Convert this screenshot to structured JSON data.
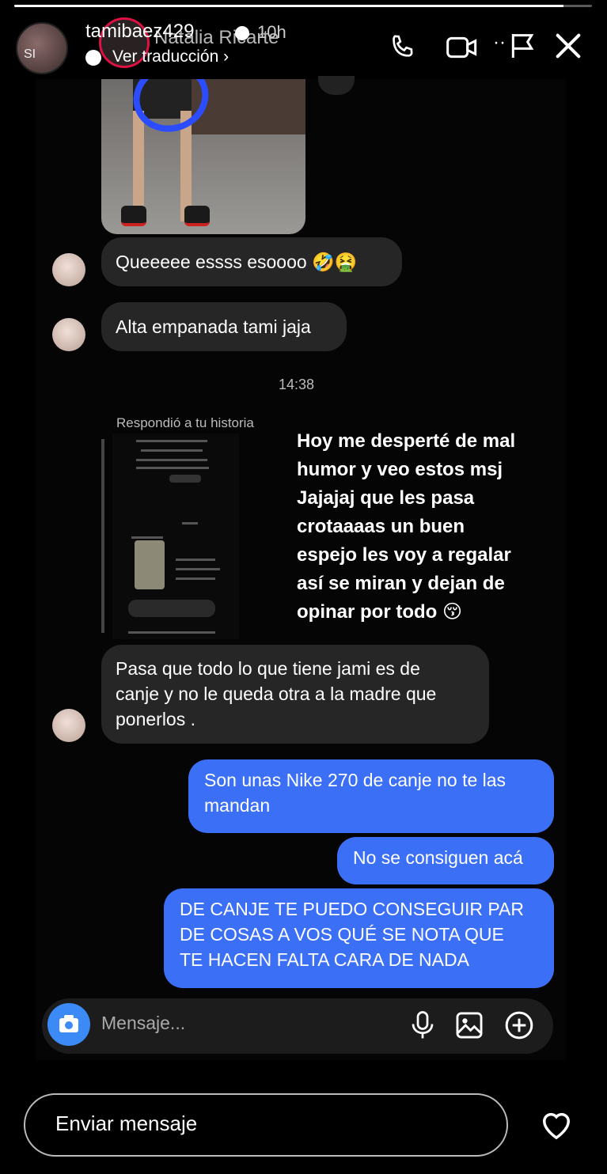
{
  "story": {
    "progress": 0.95,
    "username": "tamibaez429",
    "chat_contact": "Natalia Ricarte",
    "time": "10h",
    "translate": "Ver traducción",
    "avatar_text": "SI",
    "reply_placeholder": "Enviar mensaje"
  },
  "chat": {
    "messages_in": [
      {
        "text": "Queeeee essss esoooo 🤣🤮"
      },
      {
        "text": "Alta empanada tami jaja"
      }
    ],
    "timestamp": "14:38",
    "replied_label": "Respondió a tu historia",
    "long_in_lines": [
      "Pasa que todo lo que tiene jami es de",
      "canje y no le queda otra a la madre que",
      "ponerlos ."
    ],
    "out_messages": [
      {
        "lines": [
          "Son unas Nike 270 de canje no te las",
          "mandan"
        ]
      },
      {
        "lines": [
          "No se consiguen acá"
        ]
      },
      {
        "lines": [
          "DE CANJE TE PUEDO CONSEGUIR PAR",
          "DE COSAS A VOS QUÉ SE NOTA QUE",
          "TE HACEN FALTA CARA DE NADA"
        ]
      }
    ],
    "composer_placeholder": "Mensaje..."
  },
  "overlay_lines": [
    "Hoy me desperté de mal",
    "humor y veo estos msj",
    "Jajajaj que les pasa",
    "crotaaaas un buen",
    "espejo les voy a regalar",
    "así se miran y dejan de",
    "opinar por todo 😚"
  ],
  "icons": {
    "phone": "phone-icon",
    "video": "video-icon",
    "flag": "flag-icon",
    "close": "close-icon",
    "camera": "camera-icon",
    "mic": "microphone-icon",
    "gallery": "gallery-icon",
    "plus": "plus-circle-icon",
    "heart": "heart-icon"
  }
}
